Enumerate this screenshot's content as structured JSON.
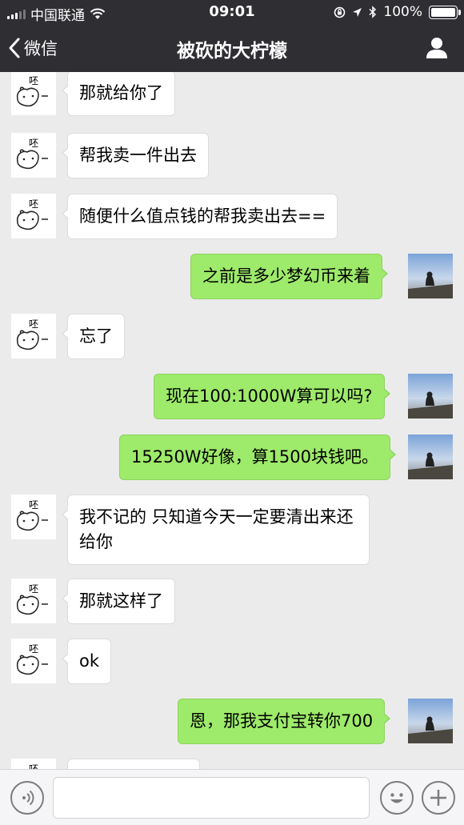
{
  "status_bar": {
    "carrier": "中国联通",
    "time": "09:01",
    "battery": "100%"
  },
  "nav": {
    "back_label": "微信",
    "title": "被砍的大柠檬"
  },
  "contact_avatar_text": "呸",
  "messages": [
    {
      "side": "left",
      "text": "那就给你了"
    },
    {
      "side": "left",
      "text": "帮我卖一件出去"
    },
    {
      "side": "left",
      "text": "随便什么值点钱的帮我卖出去=="
    },
    {
      "side": "right",
      "text": "之前是多少梦幻币来着"
    },
    {
      "side": "left",
      "text": "忘了"
    },
    {
      "side": "right",
      "text": "现在100:1000W算可以吗?"
    },
    {
      "side": "right",
      "text": "15250W好像，算1500块钱吧。"
    },
    {
      "side": "left",
      "text": "我不记的 只知道今天一定要清出来还给你"
    },
    {
      "side": "left",
      "text": "那就这样了"
    },
    {
      "side": "left",
      "text": "ok"
    },
    {
      "side": "right",
      "text": "恩，那我支付宝转你700"
    },
    {
      "side": "left",
      "text": ""
    }
  ],
  "colors": {
    "header_bg": "#2e2e33",
    "chat_bg": "#ebebeb",
    "sent_bubble": "#9eea6a",
    "received_bubble": "#ffffff"
  }
}
